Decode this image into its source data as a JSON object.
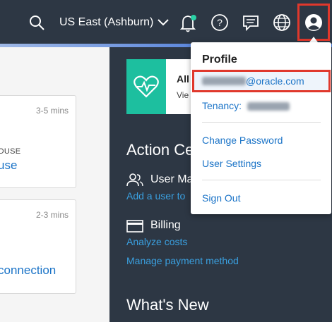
{
  "header": {
    "region_label": "US East (Ashburn)",
    "icons": [
      "search-icon",
      "chevron-down-icon",
      "bell-icon",
      "help-icon",
      "chat-icon",
      "globe-icon",
      "user-icon"
    ],
    "notification_dot_color": "#2bd1a6"
  },
  "left_cards": [
    {
      "time": "3-5 mins",
      "subtitle": "OUSE",
      "link": "use"
    },
    {
      "time": "2-3 mins",
      "subtitle": "",
      "link": "connection"
    }
  ],
  "panel": {
    "promo_title": "All",
    "promo_sub": "Vie",
    "action_center_title": "Action Ce",
    "user_mgmt_label": "User Ma",
    "user_mgmt_link": "Add a user to",
    "billing_label": "Billing",
    "billing_link1": "Analyze costs",
    "billing_link2": "Manage payment method",
    "whats_new_title": "What's New"
  },
  "profile_menu": {
    "title": "Profile",
    "email_suffix": "@oracle.com",
    "tenancy_label": "Tenancy:",
    "change_password": "Change Password",
    "user_settings": "User Settings",
    "sign_out": "Sign Out"
  }
}
